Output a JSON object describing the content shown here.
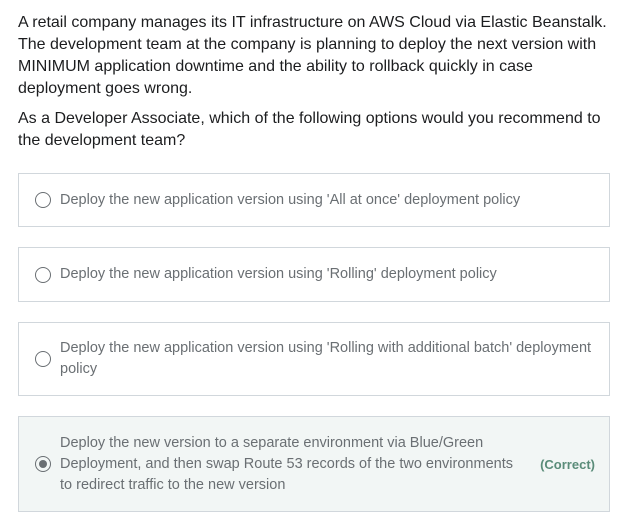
{
  "question": {
    "paragraph1": "A retail company manages its IT infrastructure on AWS Cloud via Elastic Beanstalk. The development team at the company is planning to deploy the next version with MINIMUM application downtime and the ability to rollback quickly in case deployment goes wrong.",
    "paragraph2": "As a Developer Associate, which of the following options would you recommend to the development team?"
  },
  "options": [
    {
      "text": "Deploy the new application version using 'All at once' deployment policy",
      "selected": false
    },
    {
      "text": "Deploy the new application version using 'Rolling' deployment policy",
      "selected": false
    },
    {
      "text": "Deploy the new application version using 'Rolling with additional batch' deployment policy",
      "selected": false
    },
    {
      "text": "Deploy the new version to a separate environment via Blue/Green Deployment, and then swap Route 53 records of the two environments to redirect traffic to the new version",
      "selected": true,
      "tag": "(Correct)"
    }
  ],
  "colors": {
    "text": "#1c1d1f",
    "option_text": "#6a6f73",
    "border": "#d1d7dc",
    "correct_bg": "#f2f6f5",
    "correct_tag": "#5a8c79"
  }
}
